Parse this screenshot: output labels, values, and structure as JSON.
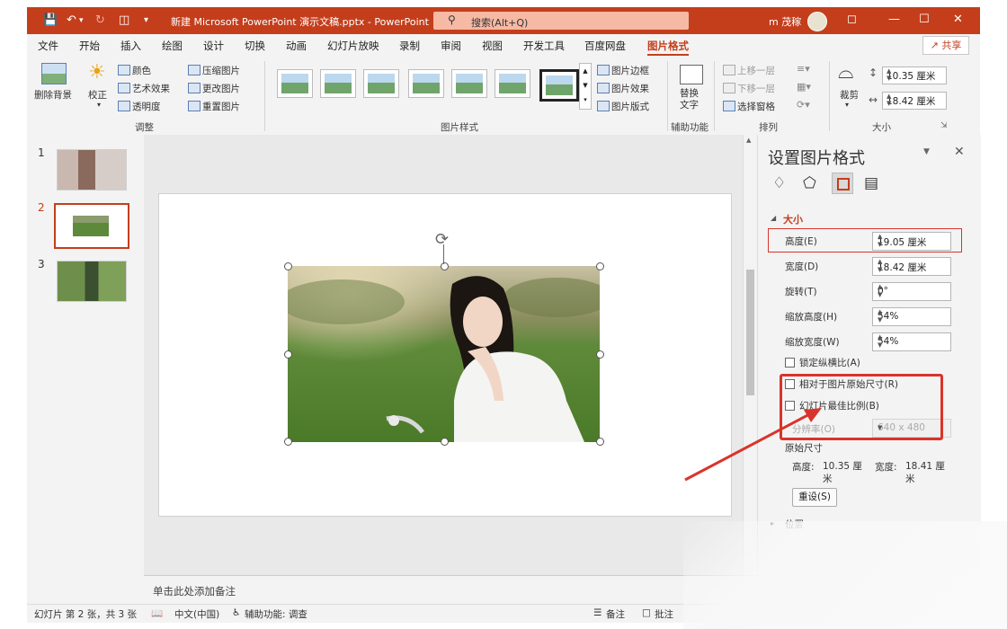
{
  "titlebar": {
    "doc_title": "新建 Microsoft PowerPoint 演示文稿.pptx  -  PowerPoint",
    "search_placeholder": "搜索(Alt+Q)",
    "user": "m 茂稼"
  },
  "menu": {
    "tabs": [
      "文件",
      "开始",
      "插入",
      "绘图",
      "设计",
      "切换",
      "动画",
      "幻灯片放映",
      "录制",
      "审阅",
      "视图",
      "开发工具",
      "百度网盘",
      "图片格式"
    ],
    "active": "图片格式",
    "share": "共享"
  },
  "ribbon": {
    "remove_bg": "删除背景",
    "correct": "校正",
    "color": "颜色",
    "art_effect": "艺术效果",
    "transparency": "透明度",
    "compress": "压缩图片",
    "change": "更改图片",
    "reset": "重置图片",
    "group_adjust": "调整",
    "group_styles": "图片样式",
    "border": "图片边框",
    "effect": "图片效果",
    "layout": "图片版式",
    "alt_text": "替换文字",
    "group_access": "辅助功能",
    "bring_forward": "上移一层",
    "send_backward": "下移一层",
    "selection_pane": "选择窗格",
    "group_arrange": "排列",
    "crop": "裁剪",
    "height_value": "10.35 厘米",
    "width_value": "18.42 厘米",
    "group_size": "大小"
  },
  "thumbnails": [
    {
      "num": "1"
    },
    {
      "num": "2"
    },
    {
      "num": "3"
    }
  ],
  "notes": "单击此处添加备注",
  "pane": {
    "title": "设置图片格式",
    "section_size": "大小",
    "height_label": "高度(E)",
    "height_value": "19.05 厘米",
    "width_label": "宽度(D)",
    "width_value": "18.42 厘米",
    "rotate_label": "旋转(T)",
    "rotate_value": "0°",
    "scale_h_label": "缩放高度(H)",
    "scale_h_value": "54%",
    "scale_w_label": "缩放宽度(W)",
    "scale_w_value": "54%",
    "lock_ratio": "锁定纵横比(A)",
    "relative_orig": "相对于图片原始尺寸(R)",
    "best_scale": "幻灯片最佳比例(B)",
    "resolution_label": "分辨率(O)",
    "resolution_value": "640 x 480",
    "orig_size": "原始尺寸",
    "orig_h_label": "高度:",
    "orig_h_value": "10.35 厘米",
    "orig_w_label": "宽度:",
    "orig_w_value": "18.41 厘米",
    "reset_button": "重设(S)",
    "position_label": "位置"
  },
  "status": {
    "slide_info": "幻灯片 第 2 张，共 3 张",
    "language": "中文(中国)",
    "accessibility": "辅助功能: 调查",
    "notes_btn": "备注",
    "comments_btn": "批注"
  },
  "colors": {
    "accent": "#c43e1c",
    "highlight_box": "#d9342b",
    "arrow": "#d9342b"
  }
}
